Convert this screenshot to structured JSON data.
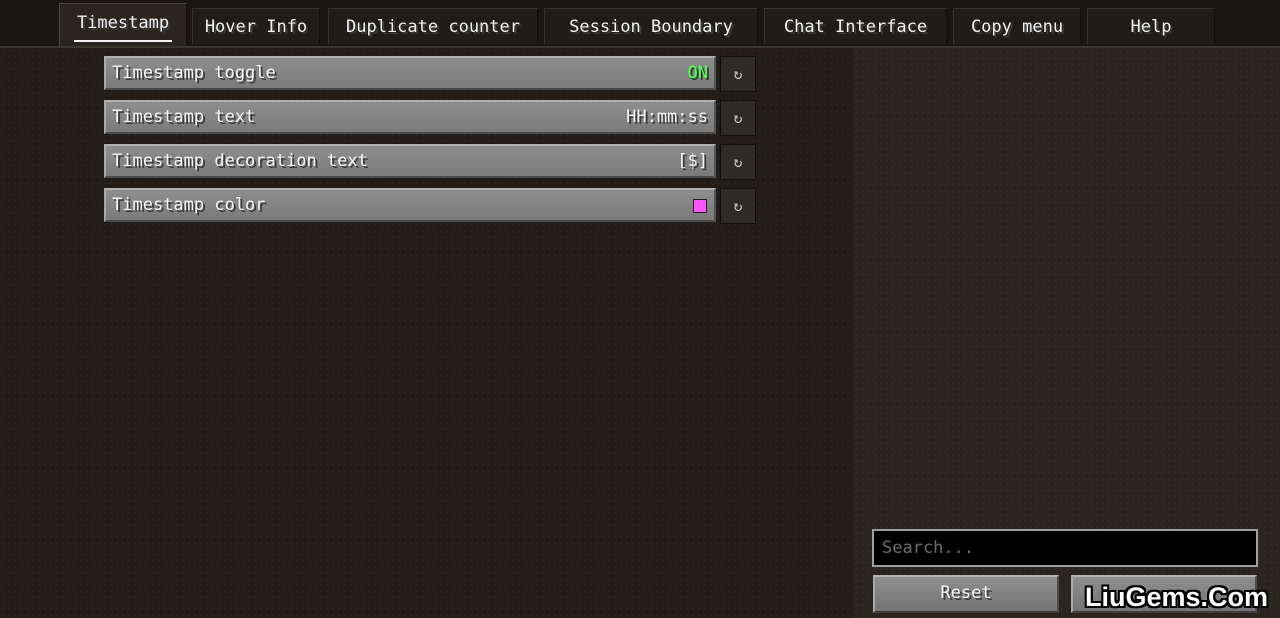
{
  "tabs": [
    {
      "label": "Timestamp",
      "active": true
    },
    {
      "label": "Hover Info"
    },
    {
      "label": "Duplicate counter"
    },
    {
      "label": "Session Boundary"
    },
    {
      "label": "Chat Interface"
    },
    {
      "label": "Copy menu"
    },
    {
      "label": "Help"
    }
  ],
  "options": [
    {
      "label": "Timestamp toggle",
      "value": "ON",
      "reset_icon": "reset-icon",
      "reset_glyph": "↻"
    },
    {
      "label": "Timestamp text",
      "value": "HH:mm:ss",
      "reset_icon": "reset-icon",
      "reset_glyph": "↻"
    },
    {
      "label": "Timestamp decoration text",
      "value": "[$]",
      "reset_icon": "reset-icon",
      "reset_glyph": "↻"
    },
    {
      "label": "Timestamp color",
      "value_color": "#ff55ff",
      "reset_icon": "reset-icon",
      "reset_glyph": "↻"
    }
  ],
  "colors": {
    "on_value": "#55ff55",
    "timestamp_color": "#ff55ff"
  },
  "search": {
    "placeholder": "Search...",
    "value": ""
  },
  "buttons": {
    "reset_label": "Reset"
  },
  "watermark": {
    "text": "LiuGems.Com"
  }
}
